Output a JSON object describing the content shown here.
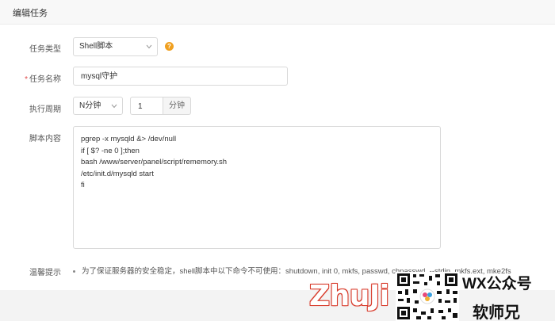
{
  "header": {
    "title": "编辑任务"
  },
  "form": {
    "task_type": {
      "label": "任务类型",
      "value": "Shell脚本",
      "help": "?"
    },
    "task_name": {
      "label": "任务名称",
      "required_mark": "*",
      "value": "mysql守护"
    },
    "period": {
      "label": "执行周期",
      "unit_select": "N分钟",
      "number": "1",
      "unit_addon": "分钟"
    },
    "script": {
      "label": "脚本内容",
      "lines": [
        "pgrep -x mysqld &> /dev/null",
        "if [ $? -ne 0 ];then",
        "bash /www/server/panel/script/rememory.sh",
        "/etc/init.d/mysqld start",
        "fi"
      ]
    },
    "tips": {
      "label": "温馨提示",
      "text": "为了保证服务器的安全稳定，shell脚本中以下命令不可使用：shutdown, init 0, mkfs, passwd, chpasswd, --stdin, mkfs.ext, mke2fs"
    }
  },
  "watermark": {
    "brand": "ZhuJi",
    "wx": "WX公众号",
    "name": "软师兄"
  },
  "colors": {
    "required": "#e04a4a",
    "help": "#f0a020",
    "watermark_red": "#d83a2a"
  }
}
